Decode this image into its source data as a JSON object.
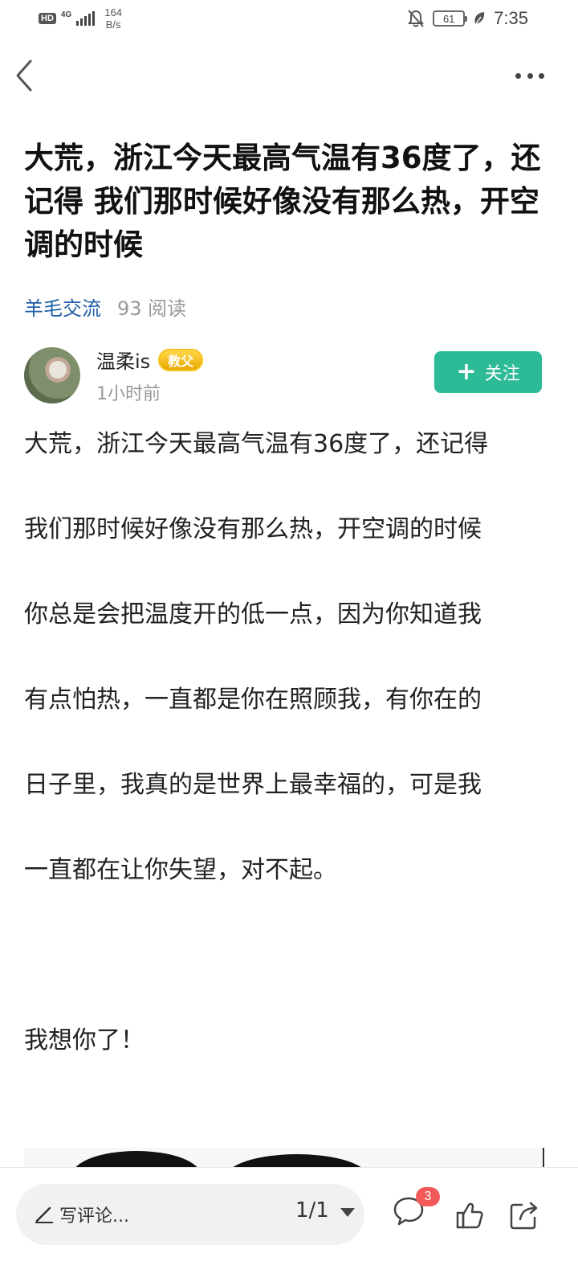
{
  "status_bar": {
    "hd": "HD",
    "network": "4G",
    "speed_value": "164",
    "speed_unit": "B/s",
    "battery": "61",
    "time": "7:35"
  },
  "post": {
    "title": "大荒，浙江今天最高气温有36度了，还记得 我们那时候好像没有那么热，开空调的时候",
    "category": "羊毛交流",
    "read_count": "93 阅读",
    "author": {
      "name": "温柔is",
      "badge": "教父",
      "time": "1小时前"
    },
    "follow_label": "关注",
    "body_lines": [
      "大荒，浙江今天最高气温有36度了，还记得",
      "我们那时候好像没有那么热，开空调的时候",
      "你总是会把温度开的低一点，因为你知道我",
      "有点怕热，一直都是你在照顾我，有你在的",
      "日子里，我真的是世界上最幸福的，可是我",
      "一直都在让你失望，对不起。"
    ],
    "closing": "我想你了！"
  },
  "bottom_bar": {
    "comment_placeholder": "写评论...",
    "page_indicator": "1/1",
    "comment_count": "3"
  },
  "colors": {
    "accent": "#2dba96",
    "link": "#1f5fa8",
    "badge": "#f25a5a"
  }
}
